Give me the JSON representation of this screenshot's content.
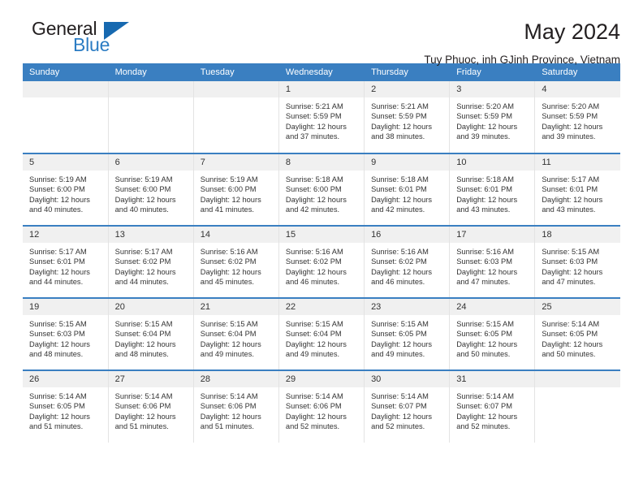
{
  "brand": {
    "line1": "General",
    "line2": "Blue",
    "triangle_icon": "brand-triangle-icon",
    "accent_color": "#2b7cc3"
  },
  "header": {
    "title": "May 2024",
    "subtitle": "Tuy Phuoc, inh GJinh Province, Vietnam"
  },
  "theme": {
    "header_blue": "#3a7fc1",
    "daynum_band": "#f0f0f0",
    "text": "#333333"
  },
  "weekdays": [
    "Sunday",
    "Monday",
    "Tuesday",
    "Wednesday",
    "Thursday",
    "Friday",
    "Saturday"
  ],
  "weeks": [
    [
      {
        "day": "",
        "sunrise": "",
        "sunset": "",
        "daylight1": "",
        "daylight2": ""
      },
      {
        "day": "",
        "sunrise": "",
        "sunset": "",
        "daylight1": "",
        "daylight2": ""
      },
      {
        "day": "",
        "sunrise": "",
        "sunset": "",
        "daylight1": "",
        "daylight2": ""
      },
      {
        "day": "1",
        "sunrise": "Sunrise: 5:21 AM",
        "sunset": "Sunset: 5:59 PM",
        "daylight1": "Daylight: 12 hours",
        "daylight2": "and 37 minutes."
      },
      {
        "day": "2",
        "sunrise": "Sunrise: 5:21 AM",
        "sunset": "Sunset: 5:59 PM",
        "daylight1": "Daylight: 12 hours",
        "daylight2": "and 38 minutes."
      },
      {
        "day": "3",
        "sunrise": "Sunrise: 5:20 AM",
        "sunset": "Sunset: 5:59 PM",
        "daylight1": "Daylight: 12 hours",
        "daylight2": "and 39 minutes."
      },
      {
        "day": "4",
        "sunrise": "Sunrise: 5:20 AM",
        "sunset": "Sunset: 5:59 PM",
        "daylight1": "Daylight: 12 hours",
        "daylight2": "and 39 minutes."
      }
    ],
    [
      {
        "day": "5",
        "sunrise": "Sunrise: 5:19 AM",
        "sunset": "Sunset: 6:00 PM",
        "daylight1": "Daylight: 12 hours",
        "daylight2": "and 40 minutes."
      },
      {
        "day": "6",
        "sunrise": "Sunrise: 5:19 AM",
        "sunset": "Sunset: 6:00 PM",
        "daylight1": "Daylight: 12 hours",
        "daylight2": "and 40 minutes."
      },
      {
        "day": "7",
        "sunrise": "Sunrise: 5:19 AM",
        "sunset": "Sunset: 6:00 PM",
        "daylight1": "Daylight: 12 hours",
        "daylight2": "and 41 minutes."
      },
      {
        "day": "8",
        "sunrise": "Sunrise: 5:18 AM",
        "sunset": "Sunset: 6:00 PM",
        "daylight1": "Daylight: 12 hours",
        "daylight2": "and 42 minutes."
      },
      {
        "day": "9",
        "sunrise": "Sunrise: 5:18 AM",
        "sunset": "Sunset: 6:01 PM",
        "daylight1": "Daylight: 12 hours",
        "daylight2": "and 42 minutes."
      },
      {
        "day": "10",
        "sunrise": "Sunrise: 5:18 AM",
        "sunset": "Sunset: 6:01 PM",
        "daylight1": "Daylight: 12 hours",
        "daylight2": "and 43 minutes."
      },
      {
        "day": "11",
        "sunrise": "Sunrise: 5:17 AM",
        "sunset": "Sunset: 6:01 PM",
        "daylight1": "Daylight: 12 hours",
        "daylight2": "and 43 minutes."
      }
    ],
    [
      {
        "day": "12",
        "sunrise": "Sunrise: 5:17 AM",
        "sunset": "Sunset: 6:01 PM",
        "daylight1": "Daylight: 12 hours",
        "daylight2": "and 44 minutes."
      },
      {
        "day": "13",
        "sunrise": "Sunrise: 5:17 AM",
        "sunset": "Sunset: 6:02 PM",
        "daylight1": "Daylight: 12 hours",
        "daylight2": "and 44 minutes."
      },
      {
        "day": "14",
        "sunrise": "Sunrise: 5:16 AM",
        "sunset": "Sunset: 6:02 PM",
        "daylight1": "Daylight: 12 hours",
        "daylight2": "and 45 minutes."
      },
      {
        "day": "15",
        "sunrise": "Sunrise: 5:16 AM",
        "sunset": "Sunset: 6:02 PM",
        "daylight1": "Daylight: 12 hours",
        "daylight2": "and 46 minutes."
      },
      {
        "day": "16",
        "sunrise": "Sunrise: 5:16 AM",
        "sunset": "Sunset: 6:02 PM",
        "daylight1": "Daylight: 12 hours",
        "daylight2": "and 46 minutes."
      },
      {
        "day": "17",
        "sunrise": "Sunrise: 5:16 AM",
        "sunset": "Sunset: 6:03 PM",
        "daylight1": "Daylight: 12 hours",
        "daylight2": "and 47 minutes."
      },
      {
        "day": "18",
        "sunrise": "Sunrise: 5:15 AM",
        "sunset": "Sunset: 6:03 PM",
        "daylight1": "Daylight: 12 hours",
        "daylight2": "and 47 minutes."
      }
    ],
    [
      {
        "day": "19",
        "sunrise": "Sunrise: 5:15 AM",
        "sunset": "Sunset: 6:03 PM",
        "daylight1": "Daylight: 12 hours",
        "daylight2": "and 48 minutes."
      },
      {
        "day": "20",
        "sunrise": "Sunrise: 5:15 AM",
        "sunset": "Sunset: 6:04 PM",
        "daylight1": "Daylight: 12 hours",
        "daylight2": "and 48 minutes."
      },
      {
        "day": "21",
        "sunrise": "Sunrise: 5:15 AM",
        "sunset": "Sunset: 6:04 PM",
        "daylight1": "Daylight: 12 hours",
        "daylight2": "and 49 minutes."
      },
      {
        "day": "22",
        "sunrise": "Sunrise: 5:15 AM",
        "sunset": "Sunset: 6:04 PM",
        "daylight1": "Daylight: 12 hours",
        "daylight2": "and 49 minutes."
      },
      {
        "day": "23",
        "sunrise": "Sunrise: 5:15 AM",
        "sunset": "Sunset: 6:05 PM",
        "daylight1": "Daylight: 12 hours",
        "daylight2": "and 49 minutes."
      },
      {
        "day": "24",
        "sunrise": "Sunrise: 5:15 AM",
        "sunset": "Sunset: 6:05 PM",
        "daylight1": "Daylight: 12 hours",
        "daylight2": "and 50 minutes."
      },
      {
        "day": "25",
        "sunrise": "Sunrise: 5:14 AM",
        "sunset": "Sunset: 6:05 PM",
        "daylight1": "Daylight: 12 hours",
        "daylight2": "and 50 minutes."
      }
    ],
    [
      {
        "day": "26",
        "sunrise": "Sunrise: 5:14 AM",
        "sunset": "Sunset: 6:05 PM",
        "daylight1": "Daylight: 12 hours",
        "daylight2": "and 51 minutes."
      },
      {
        "day": "27",
        "sunrise": "Sunrise: 5:14 AM",
        "sunset": "Sunset: 6:06 PM",
        "daylight1": "Daylight: 12 hours",
        "daylight2": "and 51 minutes."
      },
      {
        "day": "28",
        "sunrise": "Sunrise: 5:14 AM",
        "sunset": "Sunset: 6:06 PM",
        "daylight1": "Daylight: 12 hours",
        "daylight2": "and 51 minutes."
      },
      {
        "day": "29",
        "sunrise": "Sunrise: 5:14 AM",
        "sunset": "Sunset: 6:06 PM",
        "daylight1": "Daylight: 12 hours",
        "daylight2": "and 52 minutes."
      },
      {
        "day": "30",
        "sunrise": "Sunrise: 5:14 AM",
        "sunset": "Sunset: 6:07 PM",
        "daylight1": "Daylight: 12 hours",
        "daylight2": "and 52 minutes."
      },
      {
        "day": "31",
        "sunrise": "Sunrise: 5:14 AM",
        "sunset": "Sunset: 6:07 PM",
        "daylight1": "Daylight: 12 hours",
        "daylight2": "and 52 minutes."
      },
      {
        "day": "",
        "sunrise": "",
        "sunset": "",
        "daylight1": "",
        "daylight2": ""
      }
    ]
  ]
}
